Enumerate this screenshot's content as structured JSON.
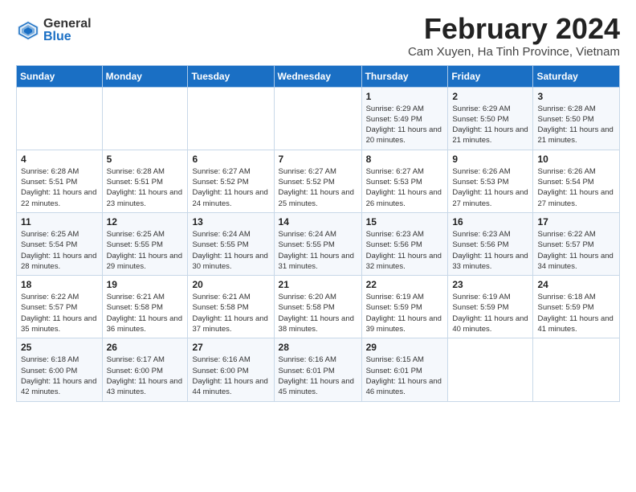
{
  "logo": {
    "general": "General",
    "blue": "Blue"
  },
  "header": {
    "title": "February 2024",
    "subtitle": "Cam Xuyen, Ha Tinh Province, Vietnam"
  },
  "weekdays": [
    "Sunday",
    "Monday",
    "Tuesday",
    "Wednesday",
    "Thursday",
    "Friday",
    "Saturday"
  ],
  "weeks": [
    [
      {
        "day": "",
        "info": ""
      },
      {
        "day": "",
        "info": ""
      },
      {
        "day": "",
        "info": ""
      },
      {
        "day": "",
        "info": ""
      },
      {
        "day": "1",
        "info": "Sunrise: 6:29 AM\nSunset: 5:49 PM\nDaylight: 11 hours and 20 minutes."
      },
      {
        "day": "2",
        "info": "Sunrise: 6:29 AM\nSunset: 5:50 PM\nDaylight: 11 hours and 21 minutes."
      },
      {
        "day": "3",
        "info": "Sunrise: 6:28 AM\nSunset: 5:50 PM\nDaylight: 11 hours and 21 minutes."
      }
    ],
    [
      {
        "day": "4",
        "info": "Sunrise: 6:28 AM\nSunset: 5:51 PM\nDaylight: 11 hours and 22 minutes."
      },
      {
        "day": "5",
        "info": "Sunrise: 6:28 AM\nSunset: 5:51 PM\nDaylight: 11 hours and 23 minutes."
      },
      {
        "day": "6",
        "info": "Sunrise: 6:27 AM\nSunset: 5:52 PM\nDaylight: 11 hours and 24 minutes."
      },
      {
        "day": "7",
        "info": "Sunrise: 6:27 AM\nSunset: 5:52 PM\nDaylight: 11 hours and 25 minutes."
      },
      {
        "day": "8",
        "info": "Sunrise: 6:27 AM\nSunset: 5:53 PM\nDaylight: 11 hours and 26 minutes."
      },
      {
        "day": "9",
        "info": "Sunrise: 6:26 AM\nSunset: 5:53 PM\nDaylight: 11 hours and 27 minutes."
      },
      {
        "day": "10",
        "info": "Sunrise: 6:26 AM\nSunset: 5:54 PM\nDaylight: 11 hours and 27 minutes."
      }
    ],
    [
      {
        "day": "11",
        "info": "Sunrise: 6:25 AM\nSunset: 5:54 PM\nDaylight: 11 hours and 28 minutes."
      },
      {
        "day": "12",
        "info": "Sunrise: 6:25 AM\nSunset: 5:55 PM\nDaylight: 11 hours and 29 minutes."
      },
      {
        "day": "13",
        "info": "Sunrise: 6:24 AM\nSunset: 5:55 PM\nDaylight: 11 hours and 30 minutes."
      },
      {
        "day": "14",
        "info": "Sunrise: 6:24 AM\nSunset: 5:55 PM\nDaylight: 11 hours and 31 minutes."
      },
      {
        "day": "15",
        "info": "Sunrise: 6:23 AM\nSunset: 5:56 PM\nDaylight: 11 hours and 32 minutes."
      },
      {
        "day": "16",
        "info": "Sunrise: 6:23 AM\nSunset: 5:56 PM\nDaylight: 11 hours and 33 minutes."
      },
      {
        "day": "17",
        "info": "Sunrise: 6:22 AM\nSunset: 5:57 PM\nDaylight: 11 hours and 34 minutes."
      }
    ],
    [
      {
        "day": "18",
        "info": "Sunrise: 6:22 AM\nSunset: 5:57 PM\nDaylight: 11 hours and 35 minutes."
      },
      {
        "day": "19",
        "info": "Sunrise: 6:21 AM\nSunset: 5:58 PM\nDaylight: 11 hours and 36 minutes."
      },
      {
        "day": "20",
        "info": "Sunrise: 6:21 AM\nSunset: 5:58 PM\nDaylight: 11 hours and 37 minutes."
      },
      {
        "day": "21",
        "info": "Sunrise: 6:20 AM\nSunset: 5:58 PM\nDaylight: 11 hours and 38 minutes."
      },
      {
        "day": "22",
        "info": "Sunrise: 6:19 AM\nSunset: 5:59 PM\nDaylight: 11 hours and 39 minutes."
      },
      {
        "day": "23",
        "info": "Sunrise: 6:19 AM\nSunset: 5:59 PM\nDaylight: 11 hours and 40 minutes."
      },
      {
        "day": "24",
        "info": "Sunrise: 6:18 AM\nSunset: 5:59 PM\nDaylight: 11 hours and 41 minutes."
      }
    ],
    [
      {
        "day": "25",
        "info": "Sunrise: 6:18 AM\nSunset: 6:00 PM\nDaylight: 11 hours and 42 minutes."
      },
      {
        "day": "26",
        "info": "Sunrise: 6:17 AM\nSunset: 6:00 PM\nDaylight: 11 hours and 43 minutes."
      },
      {
        "day": "27",
        "info": "Sunrise: 6:16 AM\nSunset: 6:00 PM\nDaylight: 11 hours and 44 minutes."
      },
      {
        "day": "28",
        "info": "Sunrise: 6:16 AM\nSunset: 6:01 PM\nDaylight: 11 hours and 45 minutes."
      },
      {
        "day": "29",
        "info": "Sunrise: 6:15 AM\nSunset: 6:01 PM\nDaylight: 11 hours and 46 minutes."
      },
      {
        "day": "",
        "info": ""
      },
      {
        "day": "",
        "info": ""
      }
    ]
  ]
}
